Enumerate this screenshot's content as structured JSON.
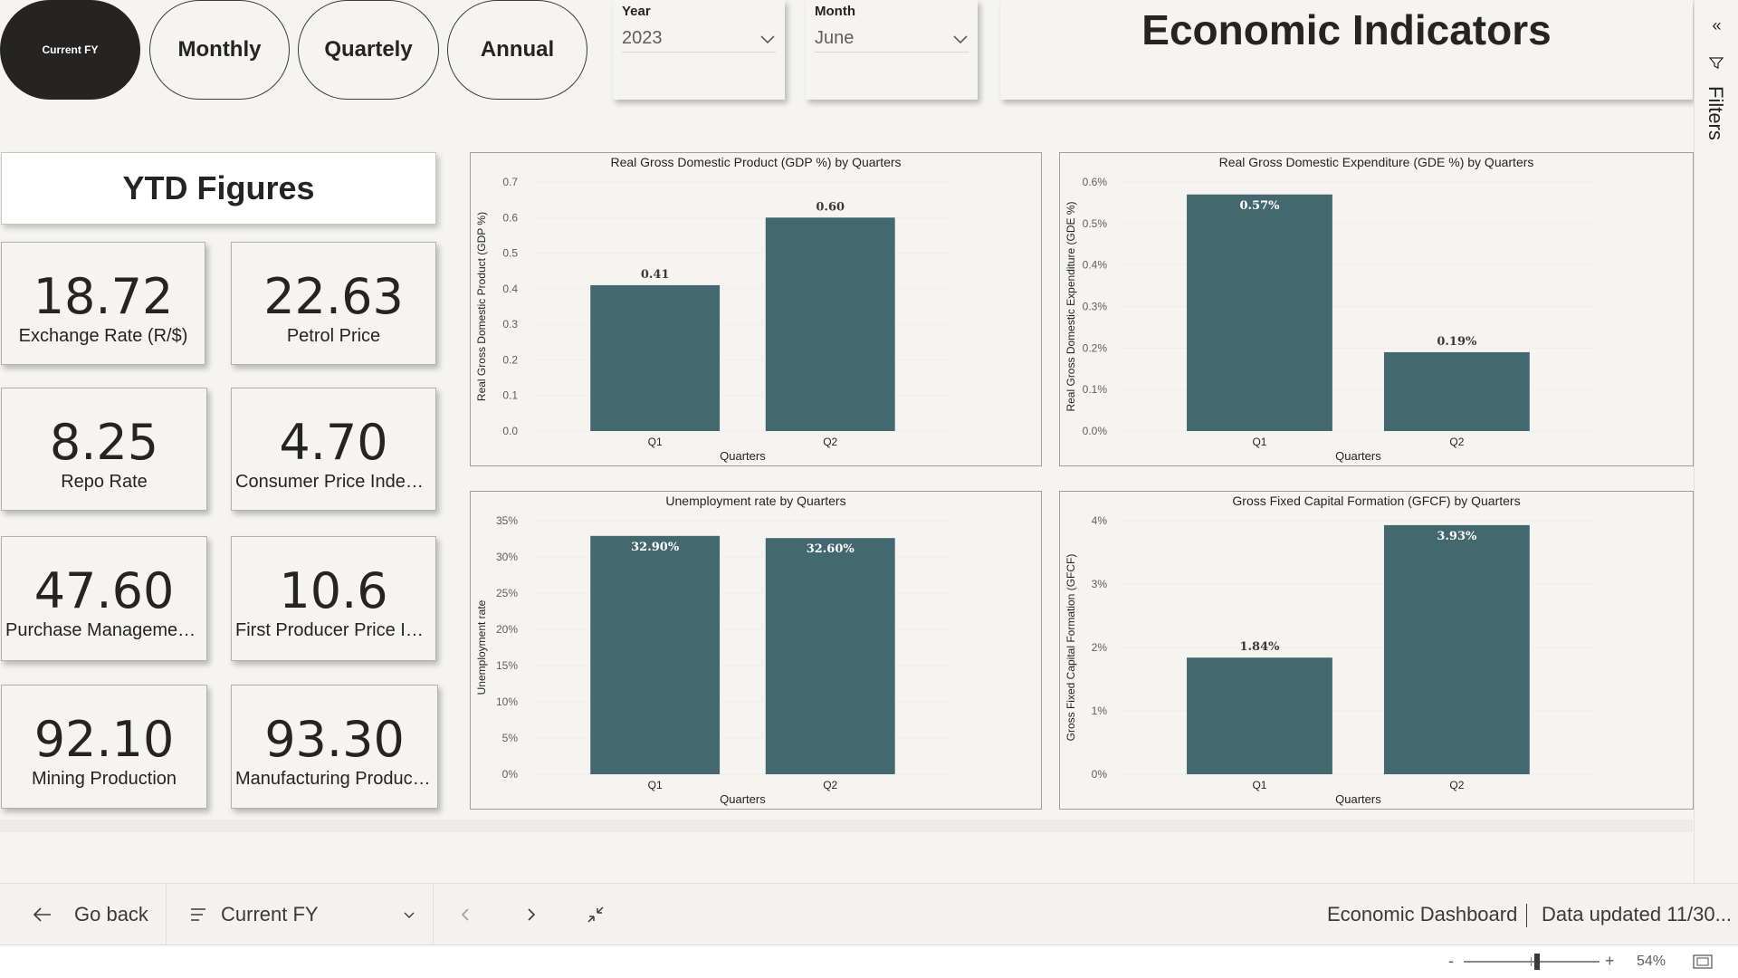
{
  "period_buttons": [
    {
      "label": "Current FY",
      "active": true
    },
    {
      "label": "Monthly",
      "active": false
    },
    {
      "label": "Quartely",
      "active": false
    },
    {
      "label": "Annual",
      "active": false
    }
  ],
  "year_slicer": {
    "label": "Year",
    "value": "2023"
  },
  "month_slicer": {
    "label": "Month",
    "value": "June"
  },
  "page_title": "Economic Indicators",
  "filters_pane": {
    "label": "Filters"
  },
  "ytd": {
    "header": "YTD Figures",
    "cards": [
      {
        "value": "18.72",
        "name": "Exchange Rate (R/$)"
      },
      {
        "value": "22.63",
        "name": "Petrol Price"
      },
      {
        "value": "8.25",
        "name": "Repo Rate"
      },
      {
        "value": "4.70",
        "name": "Consumer Price Index (..."
      },
      {
        "value": "47.60",
        "name": "Purchase Management ..."
      },
      {
        "value": "10.6",
        "name": "First Producer Price Ind..."
      },
      {
        "value": "92.10",
        "name": "Mining Production"
      },
      {
        "value": "93.30",
        "name": "Manufacturing Production"
      }
    ]
  },
  "colors": {
    "bar": "#44686f",
    "background": "#f5f4f0",
    "active_pill": "#252423"
  },
  "chart_data": [
    {
      "type": "bar",
      "title": "Real Gross Domestic Product (GDP %) by Quarters",
      "xlabel": "Quarters",
      "ylabel": "Real Gross Domestic Product (GDP %)",
      "categories": [
        "Q1",
        "Q2"
      ],
      "values": [
        0.41,
        0.6
      ],
      "data_labels": [
        "0.41",
        "0.60"
      ],
      "ylim": [
        0,
        0.7
      ],
      "yticks": [
        0,
        0.1,
        0.2,
        0.3,
        0.4,
        0.5,
        0.6,
        0.7
      ],
      "ytick_labels": [
        "0.0",
        "0.1",
        "0.2",
        "0.3",
        "0.4",
        "0.5",
        "0.6",
        "0.7"
      ],
      "grid": true
    },
    {
      "type": "bar",
      "title": "Real Gross Domestic Expenditure (GDE %) by Quarters",
      "xlabel": "Quarters",
      "ylabel": "Real Gross Domestic Expenditure (GDE %)",
      "categories": [
        "Q1",
        "Q2"
      ],
      "values": [
        0.57,
        0.19
      ],
      "data_labels": [
        "0.57%",
        "0.19%"
      ],
      "ylim": [
        0,
        0.6
      ],
      "yticks": [
        0,
        0.1,
        0.2,
        0.3,
        0.4,
        0.5,
        0.6
      ],
      "ytick_labels": [
        "0.0%",
        "0.1%",
        "0.2%",
        "0.3%",
        "0.4%",
        "0.5%",
        "0.6%"
      ],
      "grid": true
    },
    {
      "type": "bar",
      "title": "Unemployment rate by Quarters",
      "xlabel": "Quarters",
      "ylabel": "Unemployment rate",
      "categories": [
        "Q1",
        "Q2"
      ],
      "values": [
        32.9,
        32.6
      ],
      "data_labels": [
        "32.90%",
        "32.60%"
      ],
      "ylim": [
        0,
        35
      ],
      "yticks": [
        0,
        5,
        10,
        15,
        20,
        25,
        30,
        35
      ],
      "ytick_labels": [
        "0%",
        "5%",
        "10%",
        "15%",
        "20%",
        "25%",
        "30%",
        "35%"
      ],
      "grid": true
    },
    {
      "type": "bar",
      "title": "Gross Fixed Capital Formation (GFCF) by Quarters",
      "xlabel": "Quarters",
      "ylabel": "Gross Fixed Capital Formation (GFCF)",
      "categories": [
        "Q1",
        "Q2"
      ],
      "values": [
        1.84,
        3.93
      ],
      "data_labels": [
        "1.84%",
        "3.93%"
      ],
      "ylim": [
        0,
        4
      ],
      "yticks": [
        0,
        1,
        2,
        3,
        4
      ],
      "ytick_labels": [
        "0%",
        "1%",
        "2%",
        "3%",
        "4%"
      ],
      "grid": true
    }
  ],
  "bottom_bar": {
    "back_label": "Go back",
    "page_selector": "Current FY",
    "report_name": "Economic Dashboard",
    "data_updated": "Data updated 11/30..."
  },
  "zoom": {
    "minus": "-",
    "plus": "+",
    "level": "54%",
    "fraction": 0.54
  }
}
